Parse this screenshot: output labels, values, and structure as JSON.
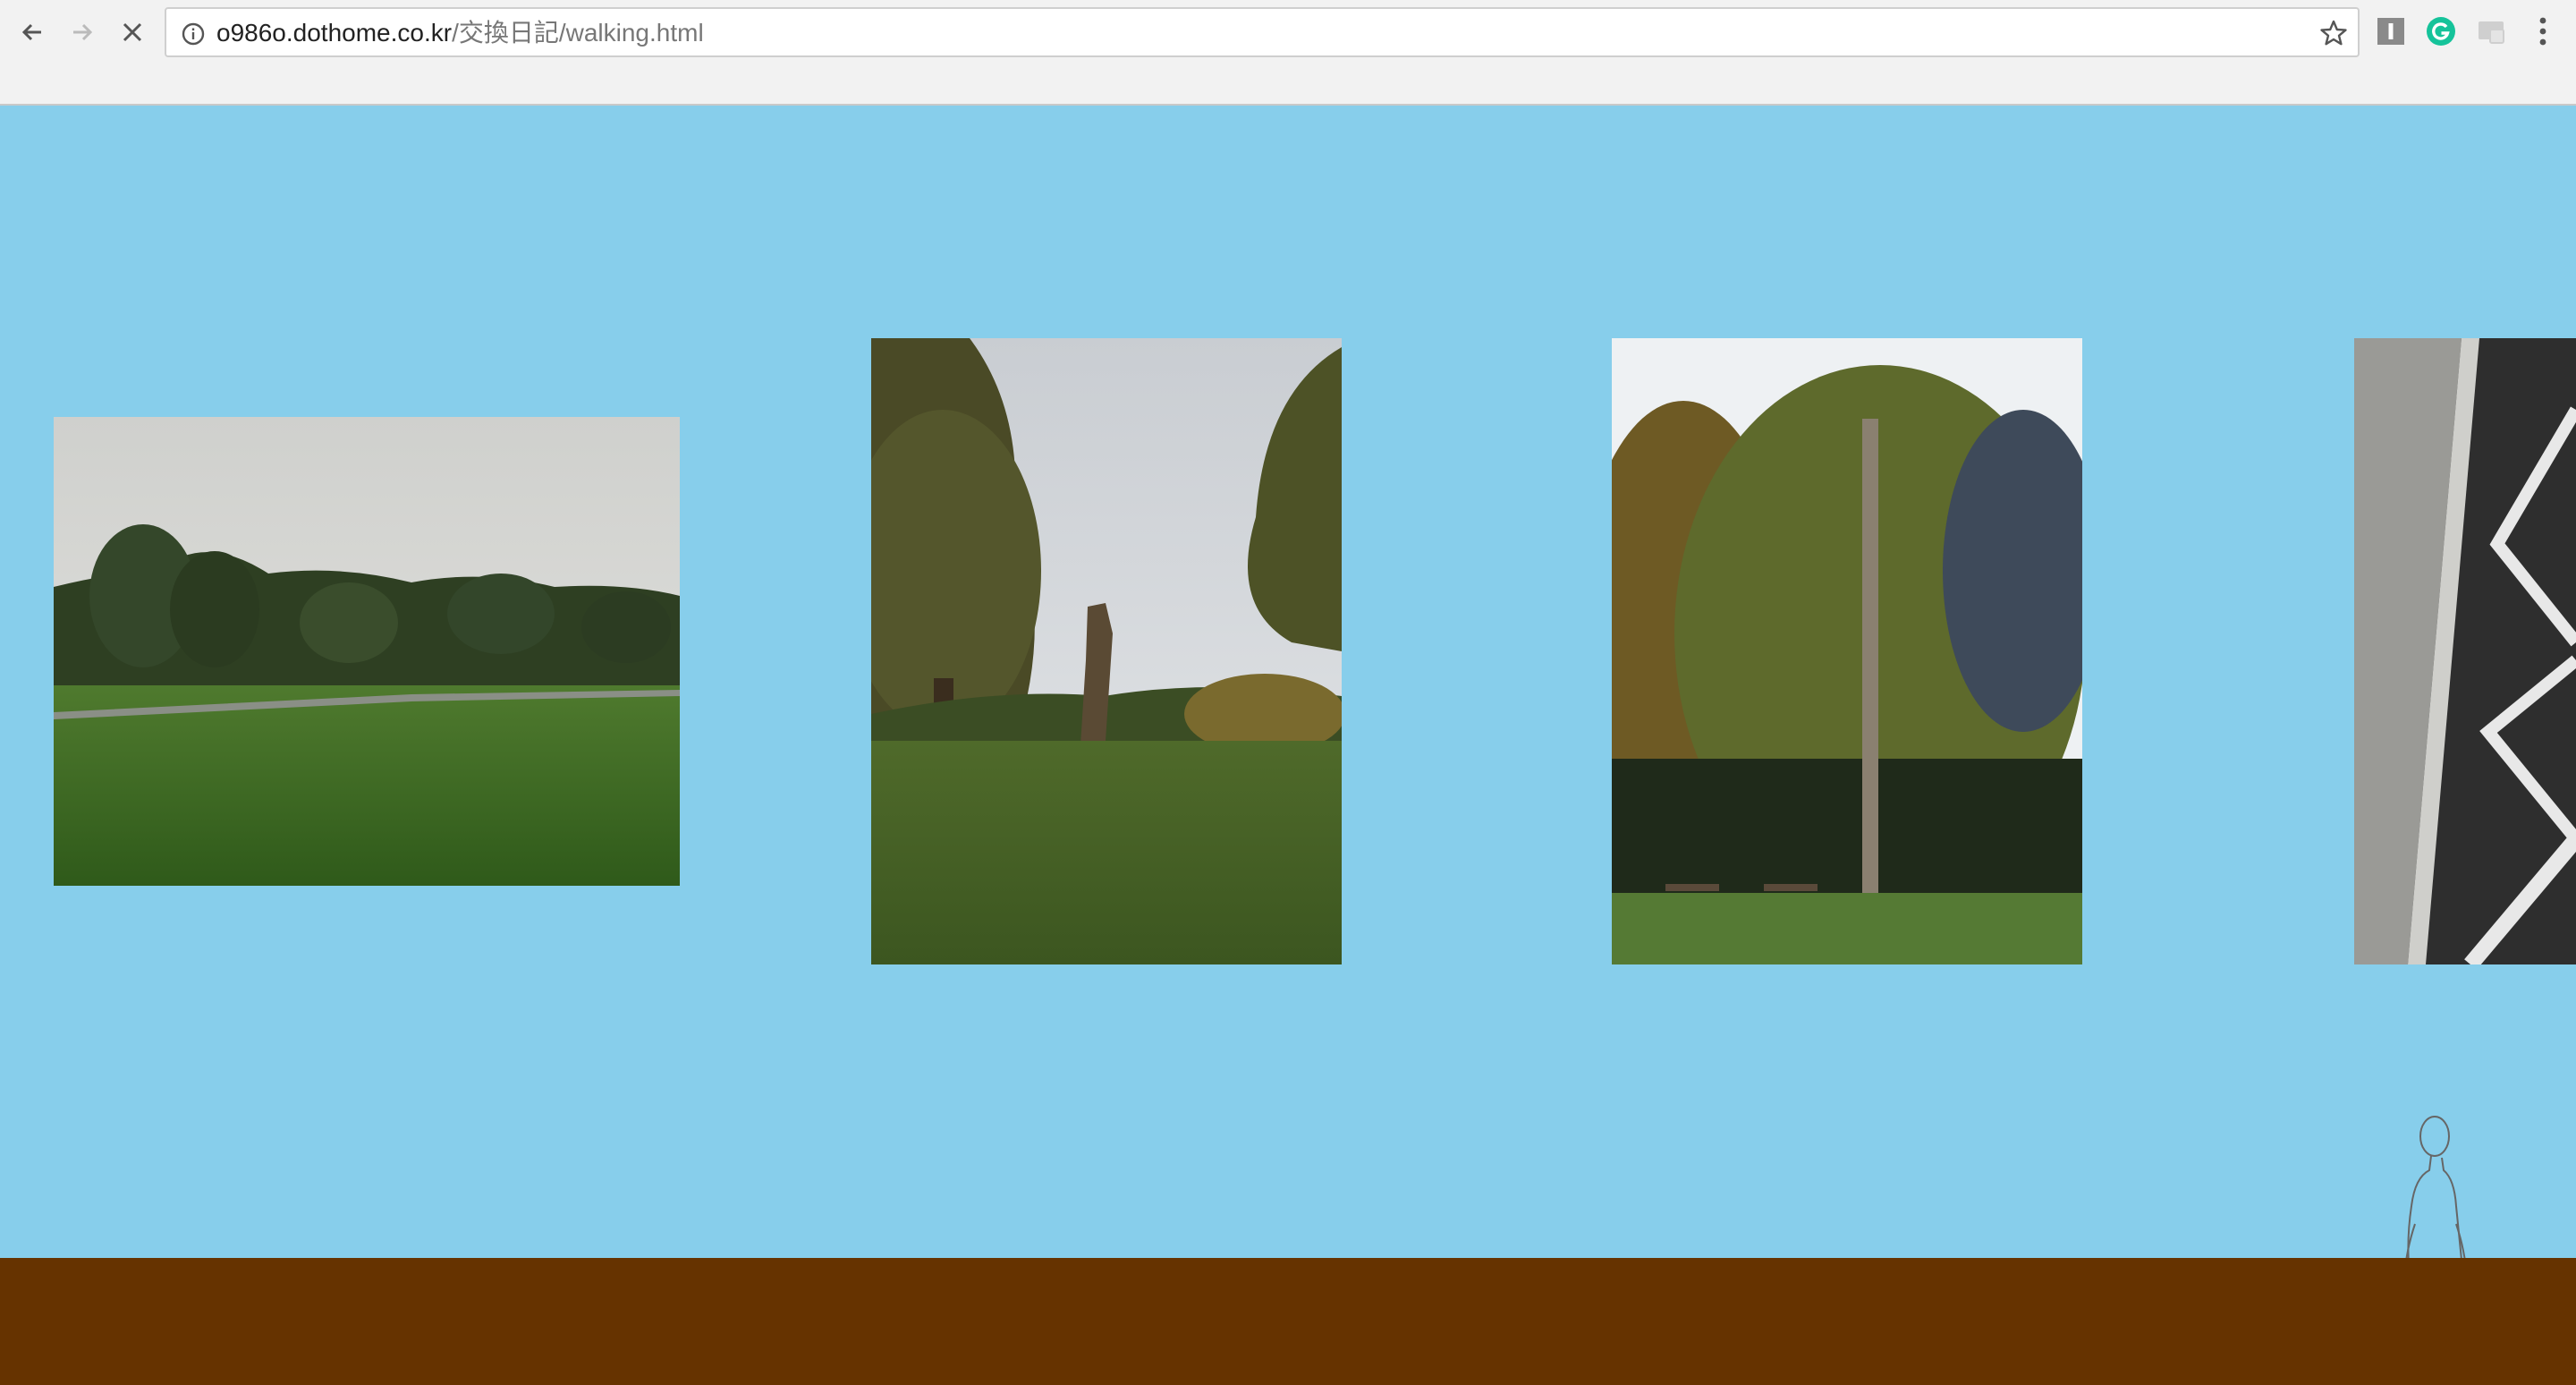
{
  "browser": {
    "url_host": "o986o.dothome.co.kr",
    "url_path": "/交換日記/walking.html",
    "nav_icons": [
      "back-arrow-icon",
      "forward-arrow-icon",
      "stop-loading-icon"
    ],
    "extension_icons": [
      "instapaper-icon",
      "grammarly-icon",
      "cast-icon",
      "menu-dots-icon"
    ]
  },
  "page": {
    "background_color": "#87ceeb",
    "grass_color": "#008000",
    "soil_color": "#663300",
    "photos": [
      {
        "name": "park-meadow-photo"
      },
      {
        "name": "tree-stump-photo"
      },
      {
        "name": "larch-tree-photo"
      },
      {
        "name": "road-markings-photo"
      }
    ],
    "character": "walking-man-figure"
  }
}
